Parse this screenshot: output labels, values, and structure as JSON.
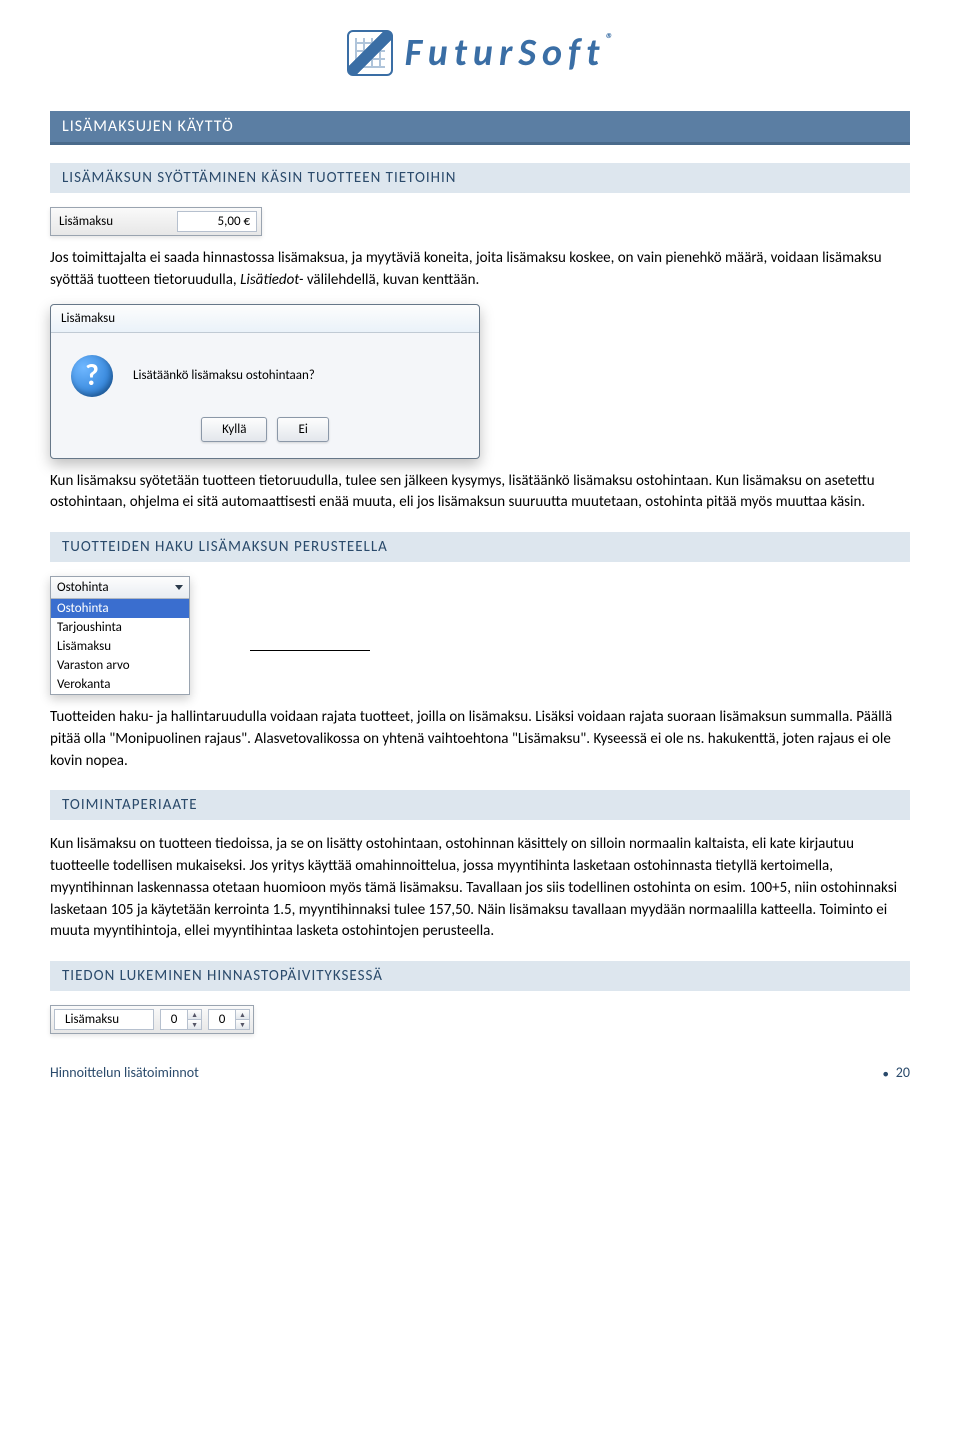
{
  "brand": "FuturSoft",
  "trademark": "®",
  "section_title": "LISÄMAKSUJEN KÄYTTÖ",
  "sub1_title": "LISÄMÄKSUN SYÖTTÄMINEN KÄSIN TUOTTEEN TIETOIHIN",
  "field": {
    "label": "Lisämaksu",
    "value": "5,00 €"
  },
  "intro": "Jos toimittajalta ei saada hinnastossa lisämaksua, ja myytäviä koneita, joita lisämaksu koskee, on vain pienehkö määrä, voidaan lisämaksu syöttää tuotteen tietoruudulla, ",
  "intro_em": "Lisätiedot-",
  "intro_tail": " välilehdellä, kuvan kenttään.",
  "dialog": {
    "title": "Lisämaksu",
    "question": "Lisätäänkö lisämaksu ostohintaan?",
    "yes": "Kyllä",
    "no": "Ei"
  },
  "after_dialog": "Kun lisämaksu syötetään tuotteen tietoruudulla, tulee sen jälkeen kysymys, lisätäänkö lisämaksu ostohintaan. Kun lisämaksu on asetettu ostohintaan, ohjelma ei sitä automaattisesti enää muuta, eli jos lisämaksun suuruutta muutetaan, ostohinta pitää myös muuttaa käsin.",
  "sub2_title": "TUOTTEIDEN HAKU LISÄMAKSUN PERUSTEELLA",
  "combo": {
    "selected": "Ostohinta",
    "options": [
      "Ostohinta",
      "Tarjoushinta",
      "Lisämaksu",
      "Varaston arvo",
      "Verokanta"
    ]
  },
  "after_combo": "Tuotteiden haku- ja hallintaruudulla voidaan rajata tuotteet, joilla on lisämaksu. Lisäksi voidaan rajata suoraan lisämaksun summalla. Päällä pitää olla \"Monipuolinen rajaus\". Alasvetovalikossa on yhtenä vaihtoehtona \"Lisämaksu\". Kyseessä ei ole ns. hakukenttä, joten rajaus ei ole kovin nopea.",
  "sub3_title": "TOIMINTAPERIAATE",
  "principle": "Kun lisämaksu on tuotteen tiedoissa, ja se on lisätty ostohintaan, ostohinnan käsittely on silloin normaalin kaltaista, eli kate kirjautuu tuotteelle todellisen mukaiseksi. Jos yritys käyttää omahinnoittelua, jossa myyntihinta lasketaan ostohinnasta tietyllä kertoimella, myyntihinnan laskennassa otetaan huomioon myös tämä lisämaksu. Tavallaan jos siis todellinen ostohinta on esim. 100+5, niin ostohinnaksi lasketaan 105 ja käytetään kerrointa 1.5, myyntihinnaksi tulee 157,50. Näin lisämaksu tavallaan myydään normaalilla katteella. Toiminto ei muuta myyntihintoja, ellei myyntihintaa lasketa ostohintojen perusteella.",
  "sub4_title": "TIEDON LUKEMINEN HINNASTOPÄIVITYKSESSÄ",
  "spinner": {
    "label": "Lisämaksu",
    "v1": "0",
    "v2": "0"
  },
  "footer": {
    "left": "Hinnoittelun lisätoiminnot",
    "right": "20"
  }
}
